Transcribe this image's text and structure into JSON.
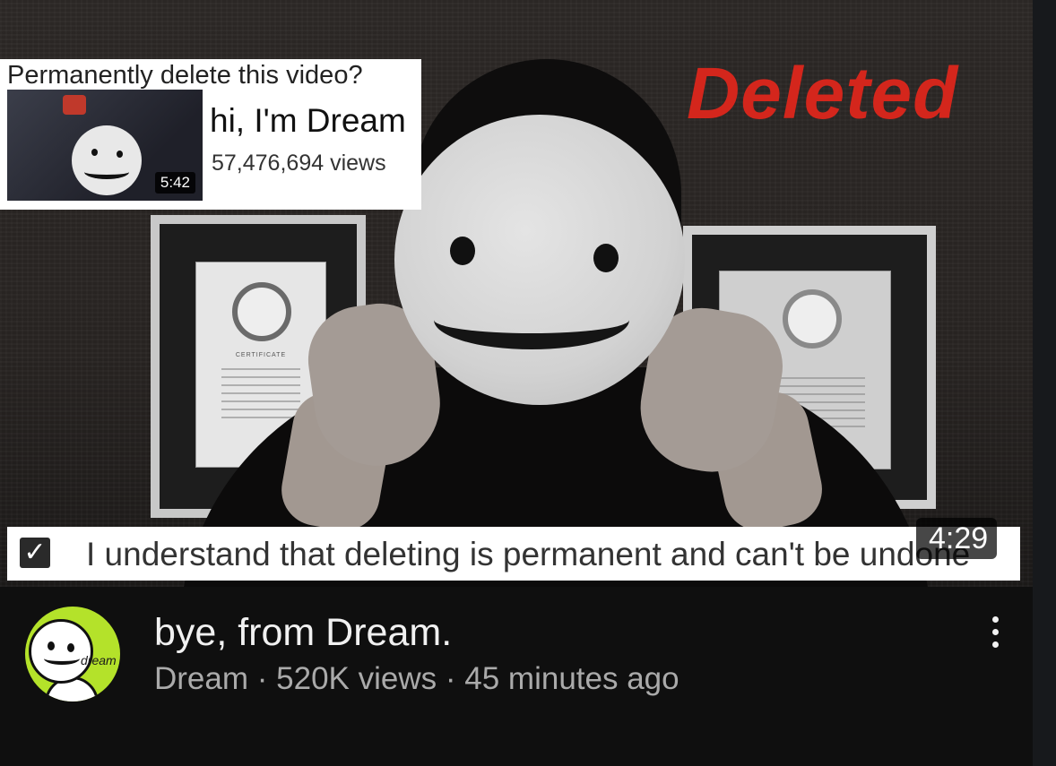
{
  "thumbnail": {
    "overlay_text": "Deleted",
    "duration": "4:29",
    "delete_dialog": {
      "title": "Permanently delete this video?",
      "video_title": "hi, I'm Dream",
      "video_views": "57,476,694 views",
      "video_duration": "5:42"
    },
    "confirm": {
      "checked": true,
      "checkmark": "✓",
      "label": "I understand that deleting is permanent and can't be undone"
    }
  },
  "video": {
    "title": "bye, from Dream.",
    "channel": "Dream",
    "separator": "·",
    "views": "520K views",
    "age": "45 minutes ago"
  },
  "avatar": {
    "word": "dream",
    "background_color": "#b4e22a"
  },
  "icons": {
    "more": "more-vert-icon",
    "checkbox": "checkbox-checked-icon"
  },
  "colors": {
    "background": "#0f0f0f",
    "title_text": "#f1f1f1",
    "meta_text": "#aaaaaa",
    "deleted_red": "#d4261c"
  }
}
